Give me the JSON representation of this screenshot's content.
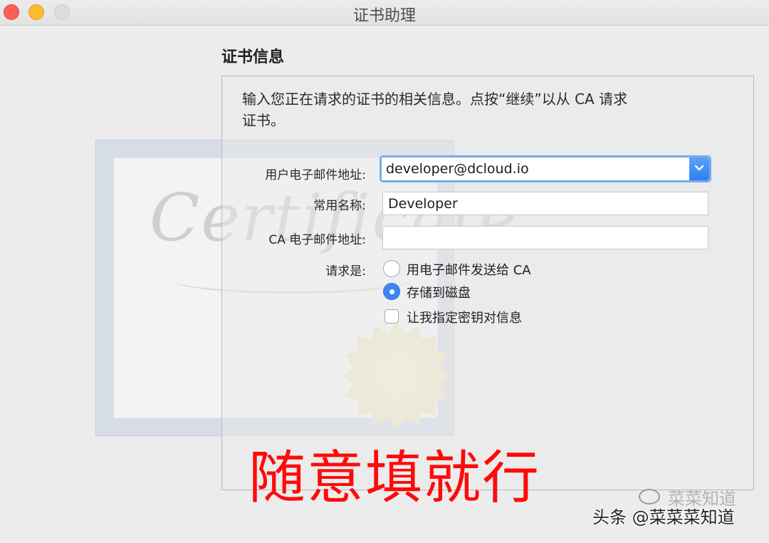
{
  "window": {
    "title": "证书助理"
  },
  "section": {
    "title": "证书信息",
    "intro_line1": "输入您正在请求的证书的相关信息。点按“继续”以从 CA 请求",
    "intro_line2": "证书。"
  },
  "form": {
    "email_label": "用户电子邮件地址:",
    "email_value": "developer@dcloud.io",
    "common_name_label": "常用名称:",
    "common_name_value": "Developer",
    "ca_email_label": "CA 电子邮件地址:",
    "ca_email_value": "",
    "request_label": "请求是:",
    "options": [
      {
        "label": "用电子邮件发送给 CA",
        "selected": false
      },
      {
        "label": "存储到磁盘",
        "selected": true
      }
    ],
    "checkbox": {
      "label": "让我指定密钥对信息",
      "checked": false
    }
  },
  "illustration": {
    "script_text": "Certificate"
  },
  "overlay": {
    "caption": "随意填就行",
    "color": "#ff0a0a"
  },
  "watermark": {
    "text": "头条 @菜菜菜知道",
    "faint": "菜菜知道"
  },
  "colors": {
    "accent": "#3b86f5",
    "close": "#fc5f57",
    "minimize": "#fdbc2e"
  }
}
